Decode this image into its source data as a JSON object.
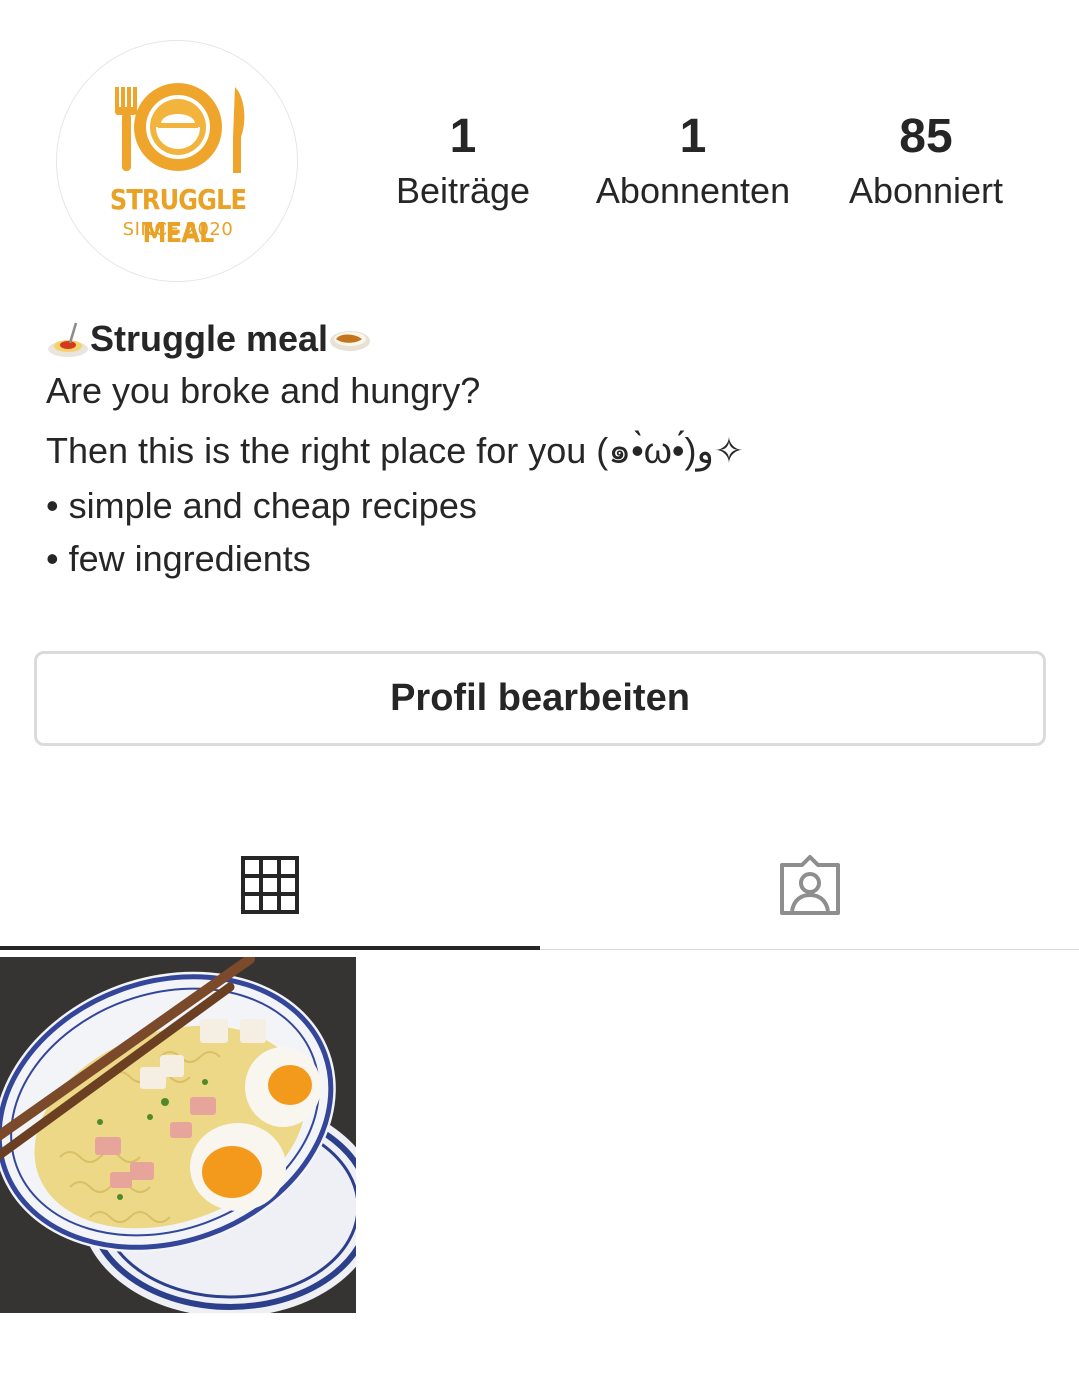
{
  "profile": {
    "avatar": {
      "brand": "STRUGGLE MEAL",
      "tagline": "SINCE 2020",
      "brand_color": "#e9a126"
    },
    "stats": [
      {
        "value": "1",
        "label": "Beiträge"
      },
      {
        "value": "1",
        "label": "Abonnenten"
      },
      {
        "value": "85",
        "label": "Abonniert"
      }
    ],
    "bio": {
      "name_prefix_icon": "spaghetti-emoji",
      "name": "Struggle meal",
      "name_suffix_icon": "curry-rice-emoji",
      "lines": [
        "Are you broke and hungry?",
        "Then this is the right place for you (๑•̀ω•́)و✧",
        "• simple and cheap recipes",
        "• few ingredients"
      ]
    },
    "edit_button_label": "Profil bearbeiten"
  },
  "tabs": [
    {
      "icon": "grid-icon",
      "active": true
    },
    {
      "icon": "tagged-person-icon",
      "active": false
    }
  ],
  "posts": [
    {
      "icon": "ramen-bowl-photo"
    }
  ],
  "colors": {
    "text": "#262626",
    "border": "#dbdbdb",
    "accent": "#e9a126"
  }
}
